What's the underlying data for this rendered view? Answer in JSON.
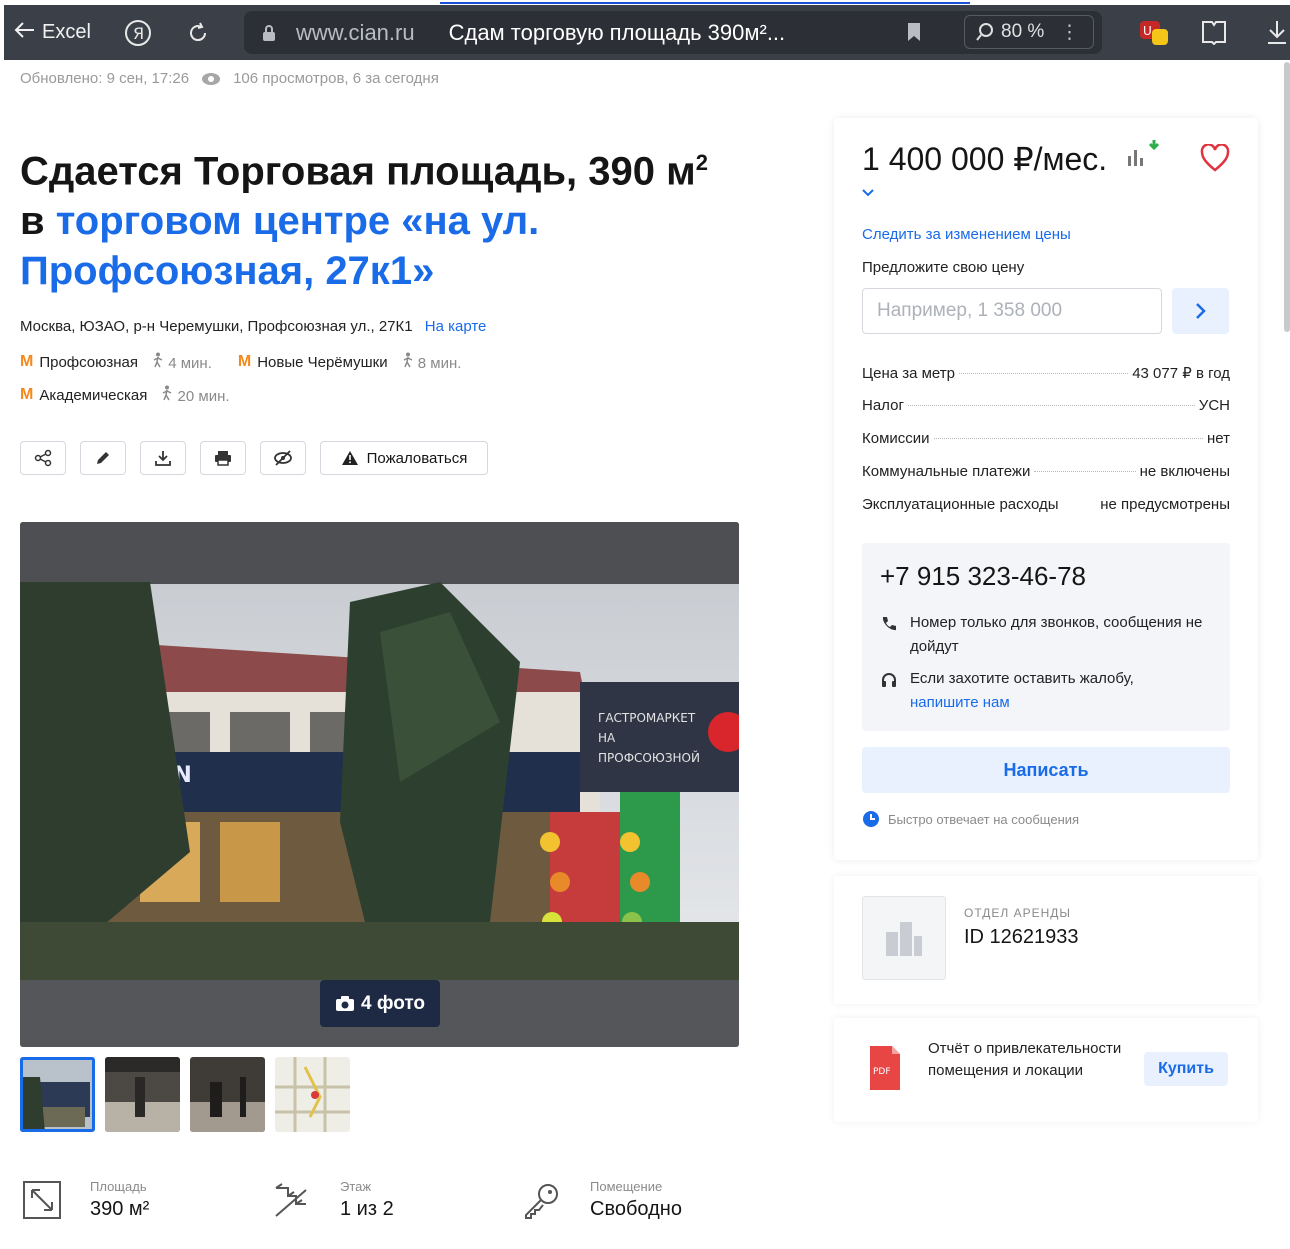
{
  "browser": {
    "back_label": "Excel",
    "domain": "www.cian.ru",
    "page_title": "Сдам торговую площадь 390м²...",
    "zoom": "80 %"
  },
  "meta": {
    "updated": "Обновлено: 9 сен, 17:26",
    "views": "106 просмотров, 6 за сегодня"
  },
  "listing": {
    "title_main": "Сдается Торговая площадь, 390 м",
    "title_sup": "2",
    "title_prefix": "в ",
    "title_link": "торговом центре «на ул. Профсоюзная, 27к1»",
    "address": "Москва, ЮЗАО, р-н Черемушки, Профсоюзная ул., 27К1",
    "map_link": "На карте",
    "metro": [
      {
        "name": "Профсоюзная",
        "time": "4 мин."
      },
      {
        "name": "Новые Черёмушки",
        "time": "8 мин."
      },
      {
        "name": "Академическая",
        "time": "20 мин."
      }
    ],
    "complain_label": "Пожаловаться",
    "photo_count": "4 фото",
    "facts": [
      {
        "label": "Площадь",
        "value": "390 м²",
        "icon": "area-icon"
      },
      {
        "label": "Этаж",
        "value": "1 из 2",
        "icon": "stairs-icon"
      },
      {
        "label": "Помещение",
        "value": "Свободно",
        "icon": "key-icon"
      }
    ]
  },
  "sidebar": {
    "price": "1 400 000 ₽/мес.",
    "follow_price": "Следить за изменением цены",
    "offer_label": "Предложите свою цену",
    "offer_placeholder": "Например, 1 358 000",
    "terms": [
      {
        "key": "Цена за метр",
        "value": "43 077 ₽ в год"
      },
      {
        "key": "Налог",
        "value": "УСН"
      },
      {
        "key": "Комиссии",
        "value": "нет"
      },
      {
        "key": "Коммунальные платежи",
        "value": "не включены"
      },
      {
        "key": "Эксплуатационные расходы",
        "value": "не предусмотрены"
      }
    ],
    "phone": "+7 915 323-46-78",
    "note_calls": "Номер только для звонков, сообщения не дойдут",
    "note_complaint": "Если захотите оставить жалобу,",
    "note_complaint_link": "напишите нам",
    "write_button": "Написать",
    "fast_reply": "Быстро отвечает на сообщения",
    "agent_dept": "ОТДЕЛ АРЕНДЫ",
    "agent_id": "ID 12621933",
    "report_text": "Отчёт о привлекательности помещения и локации",
    "buy_button": "Купить",
    "pdf_label": "PDF"
  },
  "colors": {
    "accent": "#1a6be8",
    "metro": "#f48a1b",
    "chrome": "#3b3f48",
    "heart": "#e0323f"
  }
}
